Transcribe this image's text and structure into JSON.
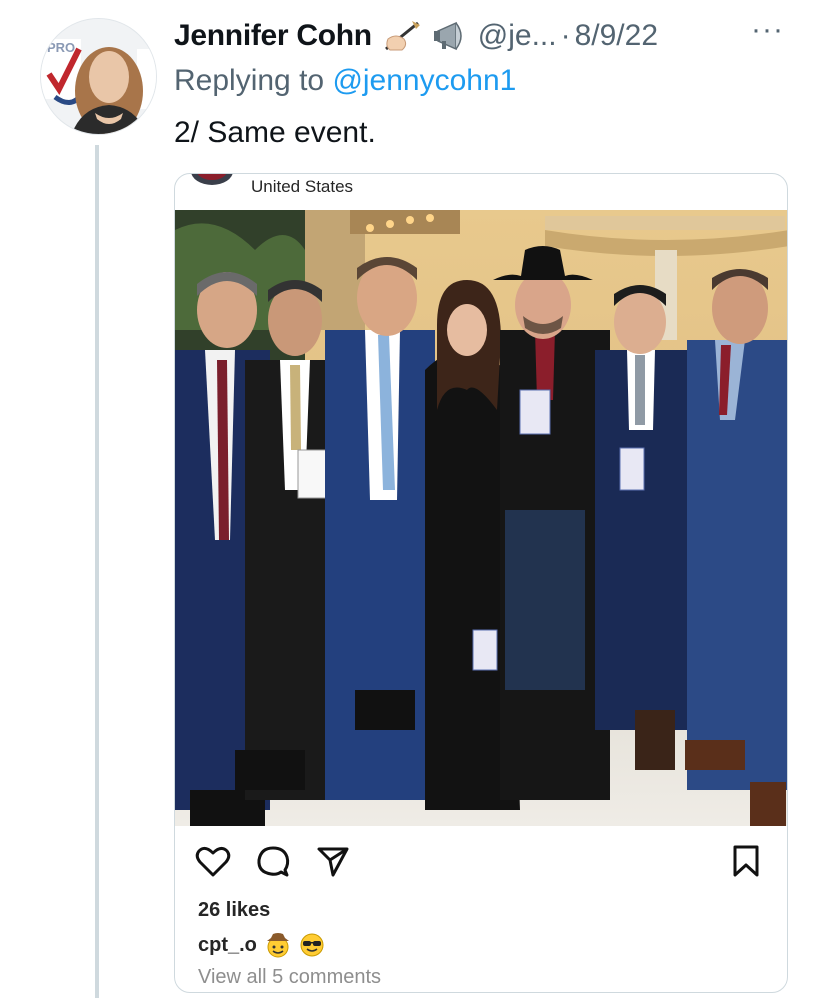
{
  "tweet": {
    "author_name": "Jennifer Cohn",
    "author_emoji_1": "writing-hand",
    "author_emoji_2": "megaphone",
    "handle": "@je...",
    "separator": "·",
    "date": "8/9/22",
    "more_label": "···",
    "replying_prefix": "Replying to",
    "replying_handle": "@jennycohn1",
    "text": "2/ Same event."
  },
  "instagram_card": {
    "location": "United States",
    "likes": "26 likes",
    "caption_user": "cpt_.o",
    "caption_emojis": [
      "cowboy-face",
      "smiling-face-with-sunglasses"
    ],
    "view_comments": "View all 5 comments",
    "action_icons": [
      "heart-icon",
      "comment-icon",
      "share-icon",
      "bookmark-icon"
    ]
  },
  "colors": {
    "link": "#1d9bf0",
    "secondary_text": "#536471",
    "border": "#cfd9de",
    "suit_blue": "#1c2d5e"
  }
}
